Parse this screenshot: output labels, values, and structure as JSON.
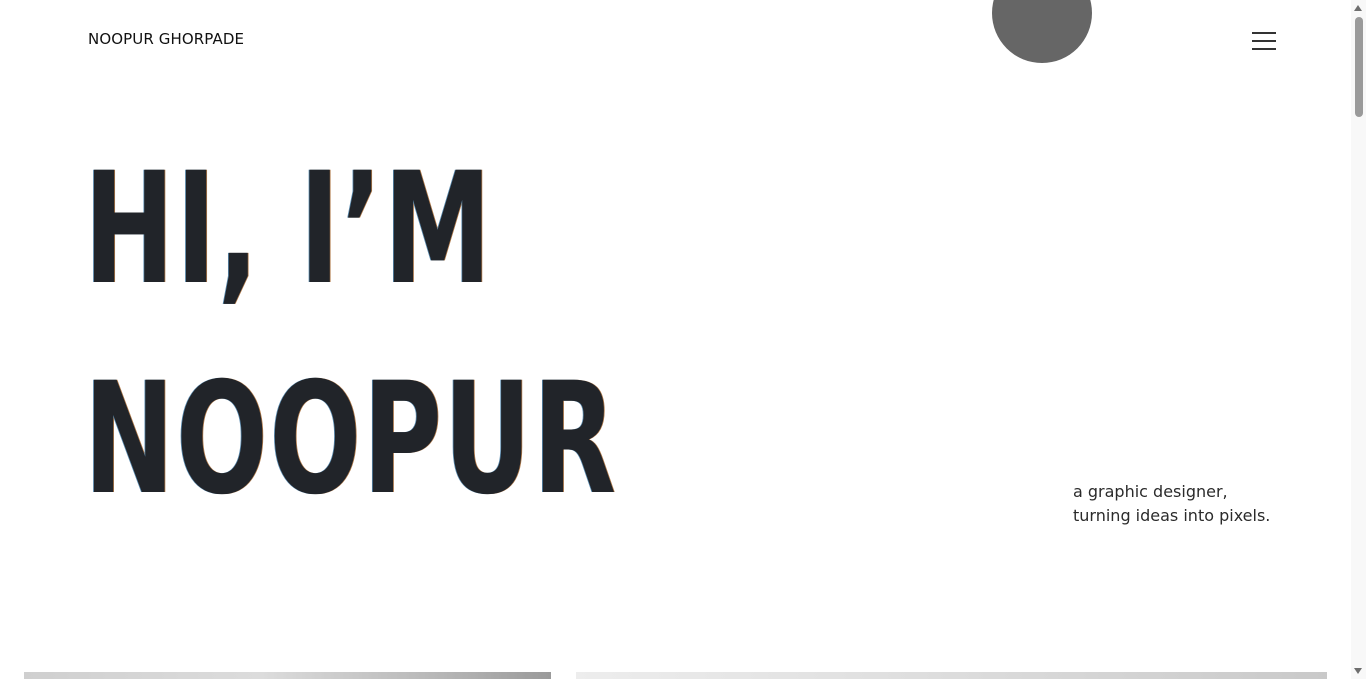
{
  "header": {
    "brand": "NOOPUR GHORPADE",
    "menu_icon": "hamburger-menu-icon",
    "decor_circle_color": "#666666"
  },
  "hero": {
    "line1": "HI, I’M",
    "line2": "NOOPUR",
    "text_color": "#212429"
  },
  "tagline": {
    "line1": "a graphic designer,",
    "line2": "turning ideas into pixels."
  },
  "scrollbar": {
    "up_icon": "scroll-up-arrow-icon",
    "down_icon": "scroll-down-arrow-icon"
  }
}
